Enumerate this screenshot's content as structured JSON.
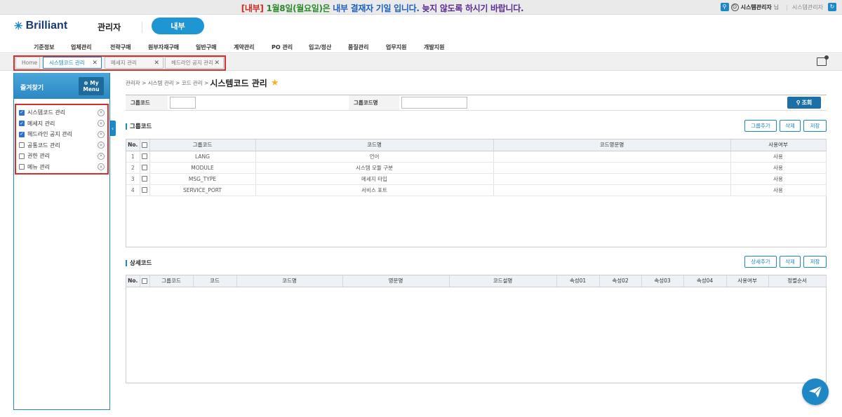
{
  "notice": {
    "part1": "[내부]",
    "part2": "1월",
    "part3": "8일(월요일)은",
    "part4": "내부 결재자 기일 입니다.",
    "part5": "늦지 않도록 하시기 바랍니다."
  },
  "user": {
    "name": "시스템관리자",
    "suffix": "님",
    "role": "시스템관리자"
  },
  "header": {
    "logo": "Brilliant",
    "role_title": "관리자",
    "pill": "내부"
  },
  "menu": [
    "기준정보",
    "업체관리",
    "전략구매",
    "원부자재구매",
    "일반구매",
    "계약관리",
    "PO 관리",
    "입고/정산",
    "품질관리",
    "업무지원",
    "개발지원"
  ],
  "tabs": [
    {
      "label": "Home"
    },
    {
      "label": "시스템코드 관리"
    },
    {
      "label": "메세지 관리"
    },
    {
      "label": "헤드라인 공지 관리"
    }
  ],
  "sidebar": {
    "title": "즐겨찾기",
    "mymenu_top": "⊕ My",
    "mymenu_bottom": "Menu",
    "items": [
      {
        "label": "시스템코드 관리",
        "checked": true
      },
      {
        "label": "메세지 관리",
        "checked": true
      },
      {
        "label": "헤드라인 공지 관리",
        "checked": true
      },
      {
        "label": "공통코드 관리",
        "checked": false
      },
      {
        "label": "권한 관리",
        "checked": false
      },
      {
        "label": "메뉴 관리",
        "checked": false
      }
    ]
  },
  "breadcrumb": {
    "path": "관리자 > 시스템 관리 > 코드 관리 >",
    "current": "시스템코드 관리"
  },
  "search": {
    "group_code_label": "그룹코드",
    "group_code_value": "",
    "group_name_label": "그룹코드명",
    "group_name_value": "",
    "button": "조회"
  },
  "group_section": {
    "title": "그룹코드",
    "buttons": [
      "그룹추가",
      "삭제",
      "저장"
    ],
    "columns": [
      "No.",
      "",
      "그룹코드",
      "코드명",
      "코드영문명",
      "사용여부"
    ],
    "rows": [
      {
        "no": "1",
        "code": "LANG",
        "name": "언어",
        "en_name": "",
        "use": "사용"
      },
      {
        "no": "2",
        "code": "MODULE",
        "name": "시스템 모듈 구분",
        "en_name": "",
        "use": "사용"
      },
      {
        "no": "3",
        "code": "MSG_TYPE",
        "name": "메세지 타입",
        "en_name": "",
        "use": "사용"
      },
      {
        "no": "4",
        "code": "SERVICE_PORT",
        "name": "서비스 포트",
        "en_name": "",
        "use": "사용"
      }
    ]
  },
  "detail_section": {
    "title": "상세코드",
    "buttons": [
      "상세추가",
      "삭제",
      "저장"
    ],
    "columns": [
      "No.",
      "",
      "그룹코드",
      "코드",
      "코드명",
      "영문명",
      "코드설명",
      "속성01",
      "속성02",
      "속성03",
      "속성04",
      "사용여부",
      "정렬순서"
    ]
  },
  "colors": {
    "accent": "#1e88c7",
    "highlight_border": "#d32f2f",
    "star": "#f2b51d"
  }
}
